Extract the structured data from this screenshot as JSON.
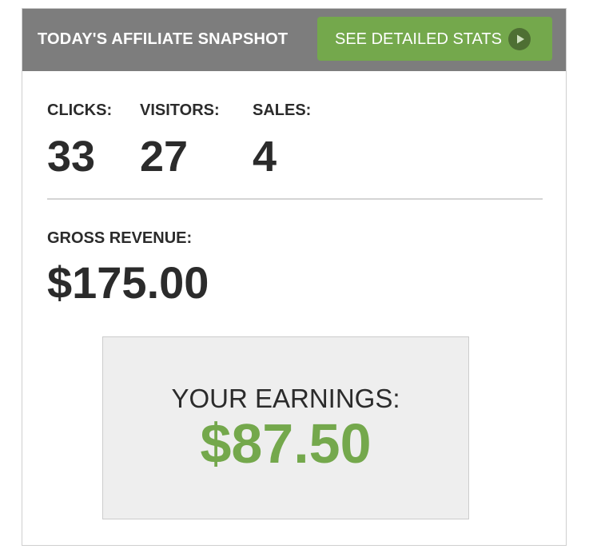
{
  "header": {
    "title": "TODAY'S AFFILIATE SNAPSHOT",
    "stats_button_label": "SEE DETAILED STATS"
  },
  "metrics": {
    "clicks": {
      "label": "CLICKS:",
      "value": "33"
    },
    "visitors": {
      "label": "VISITORS:",
      "value": "27"
    },
    "sales": {
      "label": "SALES:",
      "value": "4"
    }
  },
  "revenue": {
    "label": "GROSS REVENUE:",
    "value": "$175.00"
  },
  "earnings": {
    "label": "YOUR EARNINGS:",
    "value": "$87.50"
  },
  "colors": {
    "header_bg": "#7d7d7d",
    "accent_green": "#74a84c",
    "text_dark": "#2b2b2b",
    "earnings_box_bg": "#eeeeee"
  },
  "icons": {
    "stats_button_icon": "play-icon"
  }
}
